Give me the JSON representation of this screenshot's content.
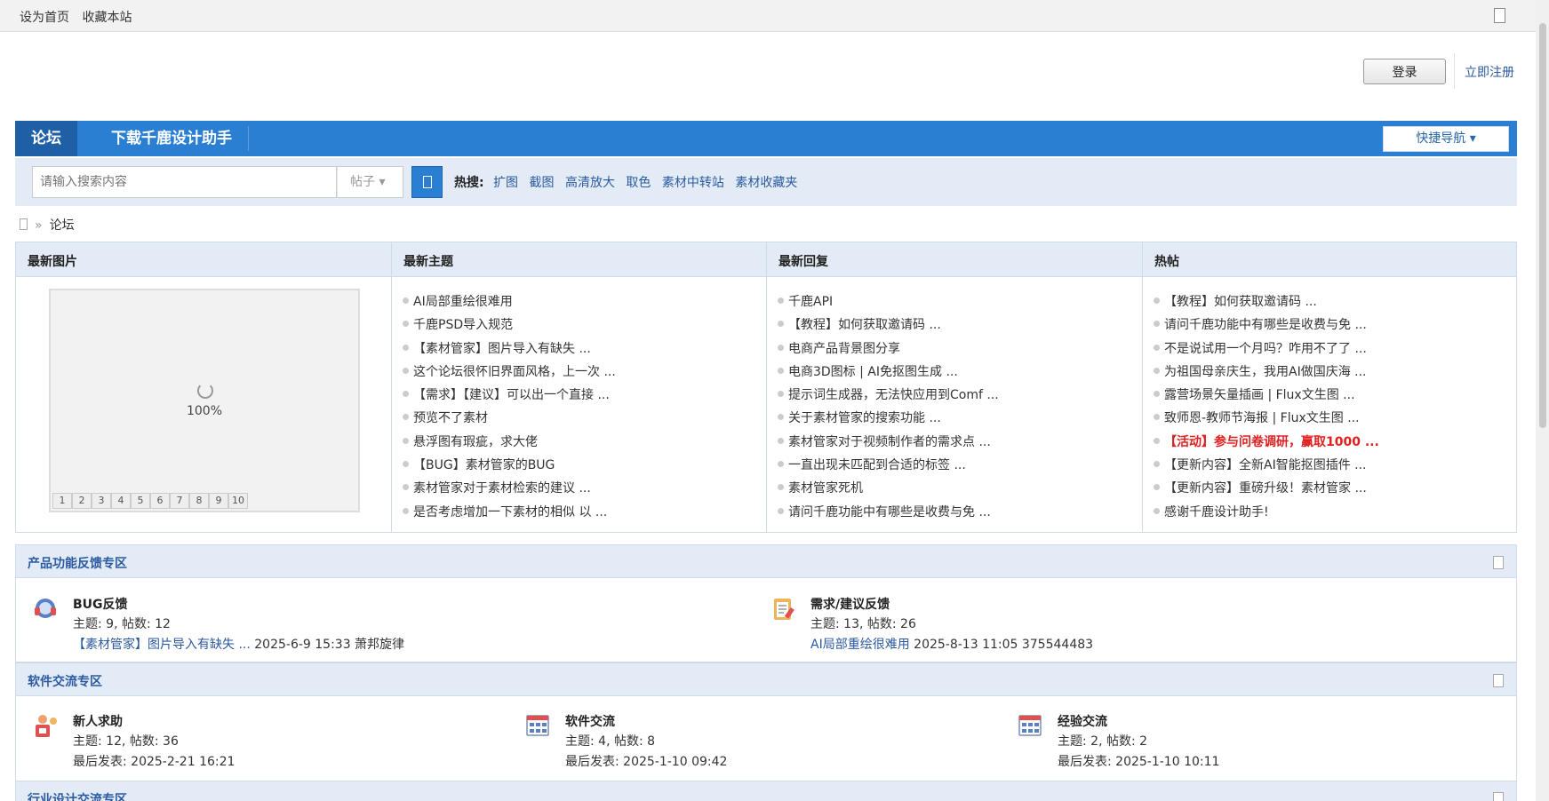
{
  "topbar": {
    "set_home": "设为首页",
    "bookmark": "收藏本站"
  },
  "header": {
    "login": "登录",
    "register": "立即注册"
  },
  "nav": {
    "forum": "论坛",
    "download": "下载千鹿设计助手",
    "quick_nav": "快捷导航"
  },
  "search": {
    "placeholder": "请输入搜索内容",
    "type": "帖子",
    "hot_label": "热搜:",
    "hot_tags": [
      "扩图",
      "截图",
      "高清放大",
      "取色",
      "素材中转站",
      "素材收藏夹"
    ]
  },
  "breadcrumb": {
    "sep": "»",
    "current": "论坛"
  },
  "grid": {
    "latest_images": {
      "title": "最新图片",
      "loading": "100%",
      "pages": [
        "1",
        "2",
        "3",
        "4",
        "5",
        "6",
        "7",
        "8",
        "9",
        "10"
      ]
    },
    "latest_threads": {
      "title": "最新主题",
      "items": [
        "AI局部重绘很难用",
        "千鹿PSD导入规范",
        "【素材管家】图片导入有缺失 ...",
        "这个论坛很怀旧界面风格，上一次 ...",
        "【需求】【建议】可以出一个直接 ...",
        "预览不了素材",
        "悬浮图有瑕疵，求大佬",
        "【BUG】素材管家的BUG",
        "素材管家对于素材检索的建议 ...",
        "是否考虑增加一下素材的相似 以 ..."
      ]
    },
    "latest_replies": {
      "title": "最新回复",
      "items": [
        "千鹿API",
        "【教程】如何获取邀请码 ...",
        "电商产品背景图分享",
        "电商3D图标 | AI免抠图生成 ...",
        "提示词生成器，无法快应用到Comf ...",
        "关于素材管家的搜索功能 ...",
        "素材管家对于视频制作者的需求点 ...",
        "一直出现未匹配到合适的标签 ...",
        "素材管家死机",
        "请问千鹿功能中有哪些是收费与免 ..."
      ]
    },
    "hot_posts": {
      "title": "热帖",
      "items": [
        "【教程】如何获取邀请码 ...",
        "请问千鹿功能中有哪些是收费与免 ...",
        "不是说试用一个月吗？咋用不了了 ...",
        "为祖国母亲庆生，我用AI做国庆海 ...",
        "露营场景矢量插画 | Flux文生图 ...",
        "致师恩-教师节海报 | Flux文生图 ...",
        "【活动】参与问卷调研，赢取1000 ...",
        "【更新内容】全新AI智能抠图插件 ...",
        "【更新内容】重磅升级！素材管家 ...",
        "感谢千鹿设计助手!"
      ]
    }
  },
  "sections": [
    {
      "title": "产品功能反馈专区",
      "forums": [
        {
          "name": "BUG反馈",
          "stats": "主题: 9, 帖数: 12",
          "last_link": "【素材管家】图片导入有缺失 ...",
          "last_meta": " 2025-6-9 15:33 萧邦旋律",
          "icon": "headset-icon"
        },
        {
          "name": "需求/建议反馈",
          "stats": "主题: 13, 帖数: 26",
          "last_link": "AI局部重绘很难用",
          "last_meta": " 2025-8-13 11:05 375544483",
          "icon": "clipboard-icon"
        }
      ]
    },
    {
      "title": "软件交流专区",
      "forums": [
        {
          "name": "新人求助",
          "stats": "主题: 12, 帖数: 36",
          "last_text": "最后发表: 2025-2-21 16:21",
          "icon": "helper-icon"
        },
        {
          "name": "软件交流",
          "stats": "主题: 4, 帖数: 8",
          "last_text": "最后发表: 2025-1-10 09:42",
          "icon": "board-icon"
        },
        {
          "name": "经验交流",
          "stats": "主题: 2, 帖数: 2",
          "last_text": "最后发表: 2025-1-10 10:11",
          "icon": "board-icon"
        }
      ]
    },
    {
      "title": "行业设计交流专区"
    }
  ],
  "colors": {
    "nav_blue": "#2a7fd3",
    "nav_active": "#1e5fa6",
    "link": "#2b5aa0",
    "highlight_red": "#e02020",
    "section_bg": "#e3ecf6"
  }
}
